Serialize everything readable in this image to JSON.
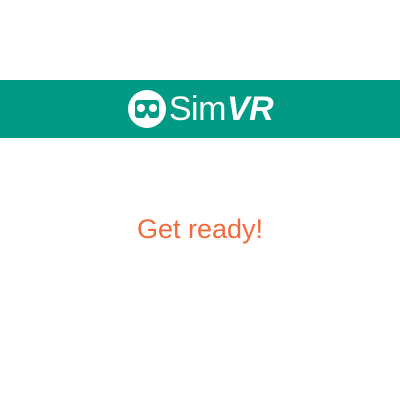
{
  "colors": {
    "header_bg": "#009a85",
    "brand_text": "#ffffff",
    "message": "#f26a3a"
  },
  "brand": {
    "icon": "vr-headset-icon",
    "name_light": "Sim",
    "name_bold": "VR"
  },
  "status": {
    "message": "Get ready!"
  }
}
